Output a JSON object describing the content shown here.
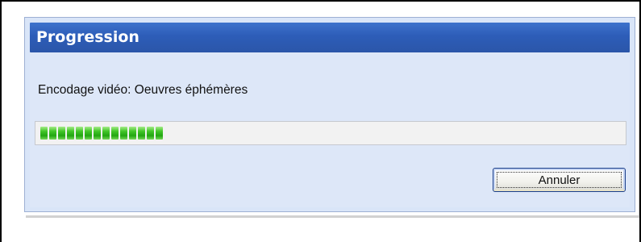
{
  "dialog": {
    "title": "Progression",
    "message": "Encodage vidéo: Oeuvres éphémères",
    "progress": {
      "fraction": 0.24,
      "segments": 14
    },
    "cancel_label": "Annuler"
  },
  "colors": {
    "titlebar": "#2d5db8",
    "body": "#dde7f8",
    "progress_green": "#2dbb1e"
  }
}
